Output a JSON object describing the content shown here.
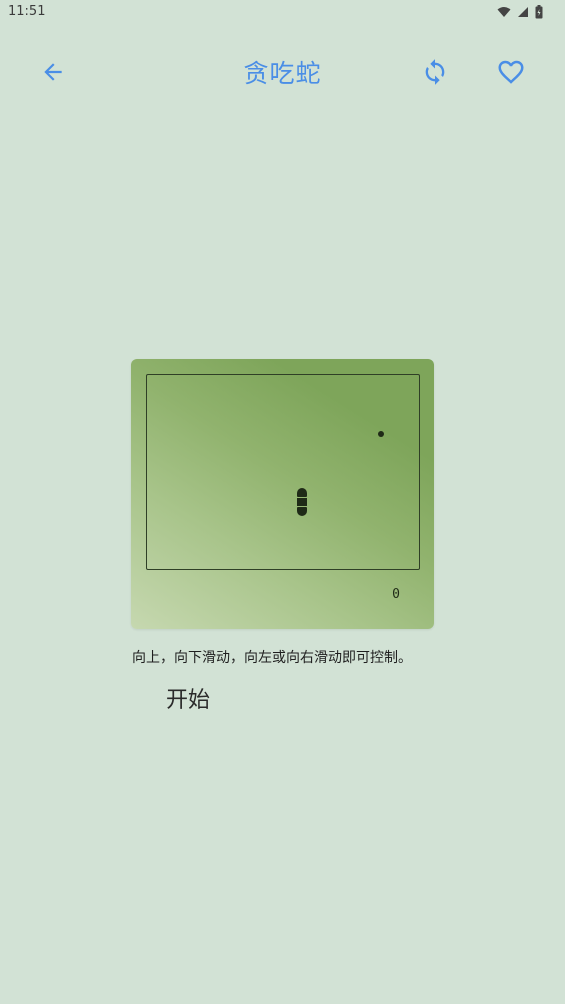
{
  "status_bar": {
    "time": "11:51",
    "icons": [
      "wifi-icon",
      "cell-signal-icon",
      "battery-icon"
    ]
  },
  "app_bar": {
    "title": "贪吃蛇",
    "back_icon": "arrow-left-icon",
    "refresh_icon": "refresh-icon",
    "favorite_icon": "heart-outline-icon",
    "accent_color": "#4a8ee6"
  },
  "game": {
    "score": "0"
  },
  "instructions": "向上，向下滑动，向左或向右滑动即可控制。",
  "start_label": "开始",
  "colors": {
    "background": "#d2e2d5",
    "board_dark": "#7ea55a",
    "board_light": "#c6d8b0",
    "pixel": "#1f2a17"
  }
}
